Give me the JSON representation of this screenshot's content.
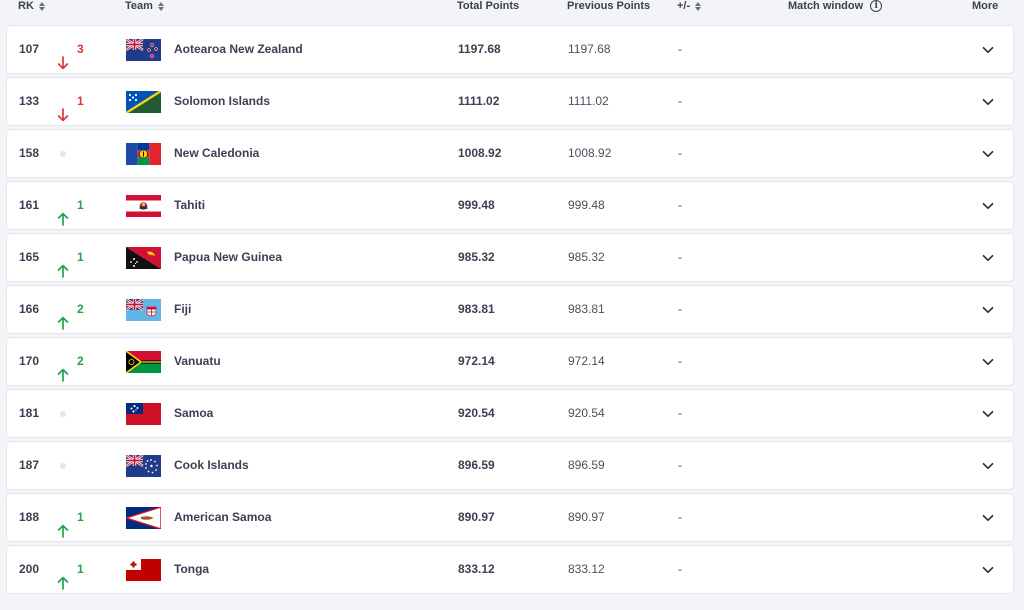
{
  "columns": {
    "rk": "RK",
    "team": "Team",
    "total_points": "Total Points",
    "previous_points": "Previous Points",
    "plus_minus": "+/-",
    "match_window": "Match window",
    "more": "More"
  },
  "rows": [
    {
      "rank": "107",
      "dir": "down",
      "change": "3",
      "team": "Aotearoa New Zealand",
      "flag": "nz",
      "total": "1197.68",
      "prev": "1197.68",
      "diff": "-"
    },
    {
      "rank": "133",
      "dir": "down",
      "change": "1",
      "team": "Solomon Islands",
      "flag": "sol",
      "total": "1111.02",
      "prev": "1111.02",
      "diff": "-"
    },
    {
      "rank": "158",
      "dir": "none",
      "change": "",
      "team": "New Caledonia",
      "flag": "ncl",
      "total": "1008.92",
      "prev": "1008.92",
      "diff": "-"
    },
    {
      "rank": "161",
      "dir": "up",
      "change": "1",
      "team": "Tahiti",
      "flag": "tah",
      "total": "999.48",
      "prev": "999.48",
      "diff": "-"
    },
    {
      "rank": "165",
      "dir": "up",
      "change": "1",
      "team": "Papua New Guinea",
      "flag": "png",
      "total": "985.32",
      "prev": "985.32",
      "diff": "-"
    },
    {
      "rank": "166",
      "dir": "up",
      "change": "2",
      "team": "Fiji",
      "flag": "fij",
      "total": "983.81",
      "prev": "983.81",
      "diff": "-"
    },
    {
      "rank": "170",
      "dir": "up",
      "change": "2",
      "team": "Vanuatu",
      "flag": "van",
      "total": "972.14",
      "prev": "972.14",
      "diff": "-"
    },
    {
      "rank": "181",
      "dir": "none",
      "change": "",
      "team": "Samoa",
      "flag": "sam",
      "total": "920.54",
      "prev": "920.54",
      "diff": "-"
    },
    {
      "rank": "187",
      "dir": "none",
      "change": "",
      "team": "Cook Islands",
      "flag": "cok",
      "total": "896.59",
      "prev": "896.59",
      "diff": "-"
    },
    {
      "rank": "188",
      "dir": "up",
      "change": "1",
      "team": "American Samoa",
      "flag": "asa",
      "total": "890.97",
      "prev": "890.97",
      "diff": "-"
    },
    {
      "rank": "200",
      "dir": "up",
      "change": "1",
      "team": "Tonga",
      "flag": "tga",
      "total": "833.12",
      "prev": "833.12",
      "diff": "-"
    }
  ],
  "colors": {
    "up": "#22a44a",
    "down": "#d63a3a",
    "text": "#3b4152",
    "background": "#f3f4f7"
  },
  "icons": {
    "sort": "sort-arrows-icon",
    "info": "info-icon",
    "expand": "chevron-down-icon",
    "up": "arrow-up-icon",
    "down": "arrow-down-icon",
    "no_change": "dot-icon"
  }
}
